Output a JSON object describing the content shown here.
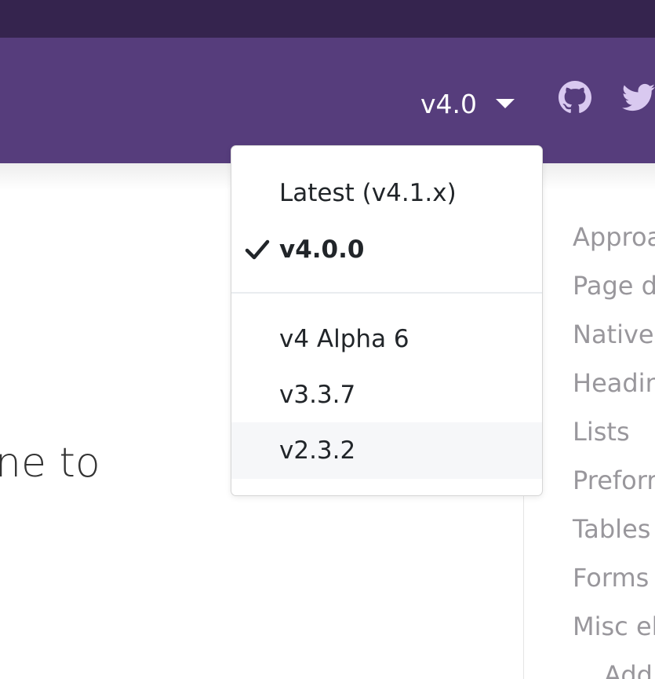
{
  "navbar": {
    "version_label": "v4.0",
    "icons": {
      "github": "github-icon",
      "twitter": "twitter-icon",
      "caret": "caret-down-icon"
    }
  },
  "hero": {
    "partial_text": "ne to"
  },
  "version_dropdown": {
    "items": [
      {
        "label": "Latest (v4.1.x)"
      },
      {
        "label": "v4.0.0",
        "active": true,
        "icon": "checkmark-icon"
      },
      {
        "label": "v4 Alpha 6"
      },
      {
        "label": "v3.3.7"
      },
      {
        "label": "v2.3.2",
        "hovered": true
      }
    ]
  },
  "toc": {
    "items": [
      {
        "label": "Approa"
      },
      {
        "label": "Page d"
      },
      {
        "label": "Native"
      },
      {
        "label": "Headin"
      },
      {
        "label": "Lists"
      },
      {
        "label": "Preforr"
      },
      {
        "label": "Tables"
      },
      {
        "label": "Forms"
      },
      {
        "label": "Misc el"
      },
      {
        "label": "Add"
      }
    ]
  },
  "colors": {
    "top_strip": "#35244e",
    "navbar": "#563d7c",
    "icon_tint": "#d9c9f0",
    "toc_text": "#99979c",
    "hover_row": "#f6f7f9"
  }
}
